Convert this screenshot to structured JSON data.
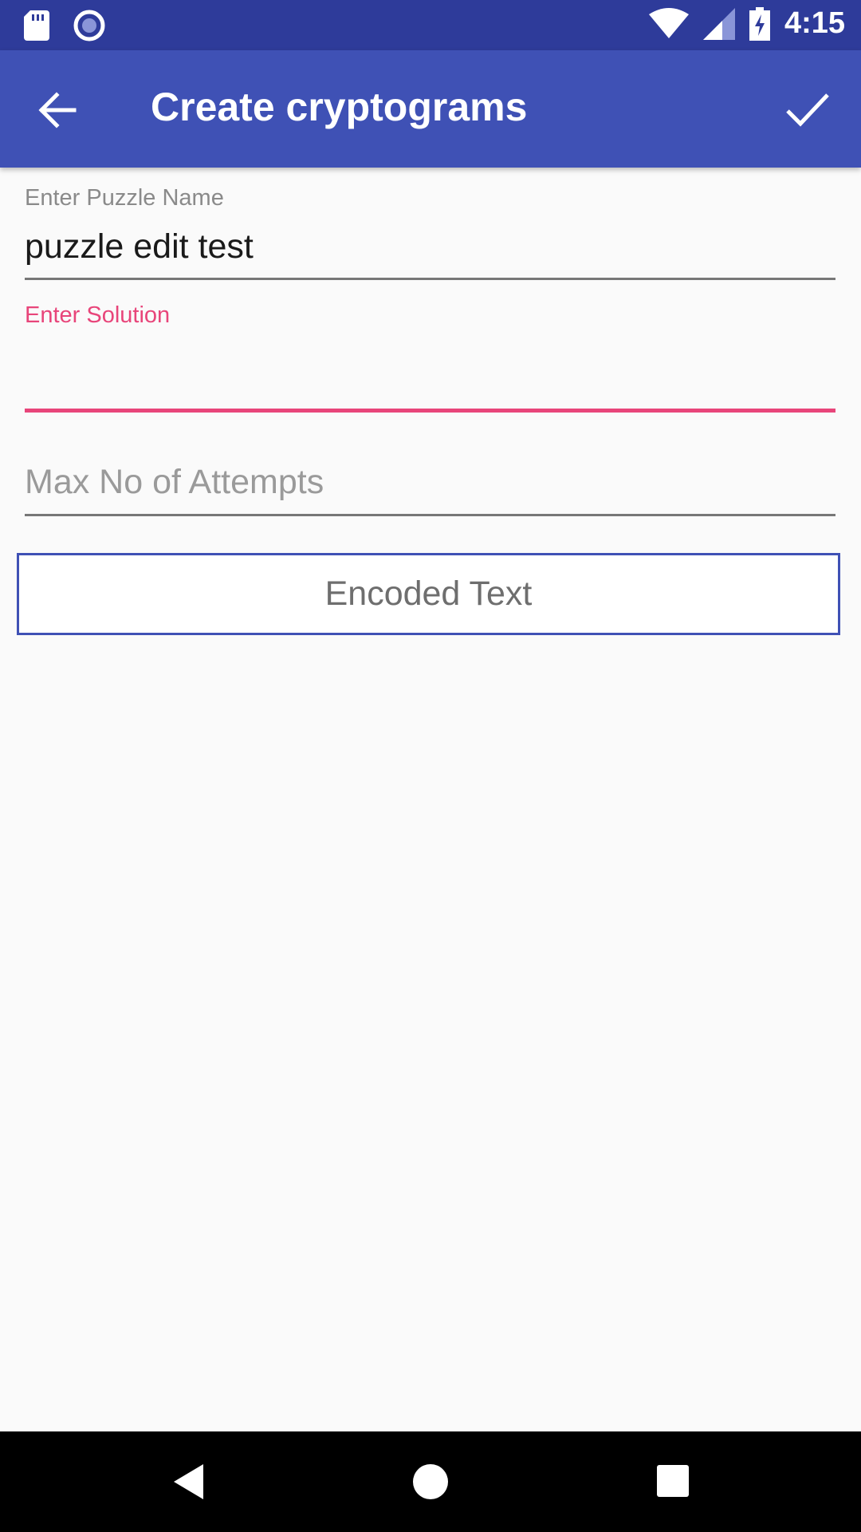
{
  "status_bar": {
    "time": "4:15",
    "icons": [
      "sd-card-icon",
      "sync-circle-icon",
      "wifi-icon",
      "signal-icon",
      "battery-charging-icon"
    ]
  },
  "app_bar": {
    "title": "Create cryptograms",
    "back_icon": "arrow-back-icon",
    "confirm_icon": "check-icon",
    "color": "#3f51b5"
  },
  "form": {
    "puzzle_name": {
      "label": "Enter Puzzle Name",
      "value": "puzzle edit test"
    },
    "solution": {
      "label": "Enter Solution",
      "value": "",
      "accent_color": "#e8457a"
    },
    "max_attempts": {
      "placeholder": "Max No of Attempts",
      "value": ""
    },
    "encoded_button": {
      "label": "Encoded Text"
    }
  },
  "nav_bar": {
    "icons": [
      "back-triangle-icon",
      "home-circle-icon",
      "recents-square-icon"
    ]
  }
}
